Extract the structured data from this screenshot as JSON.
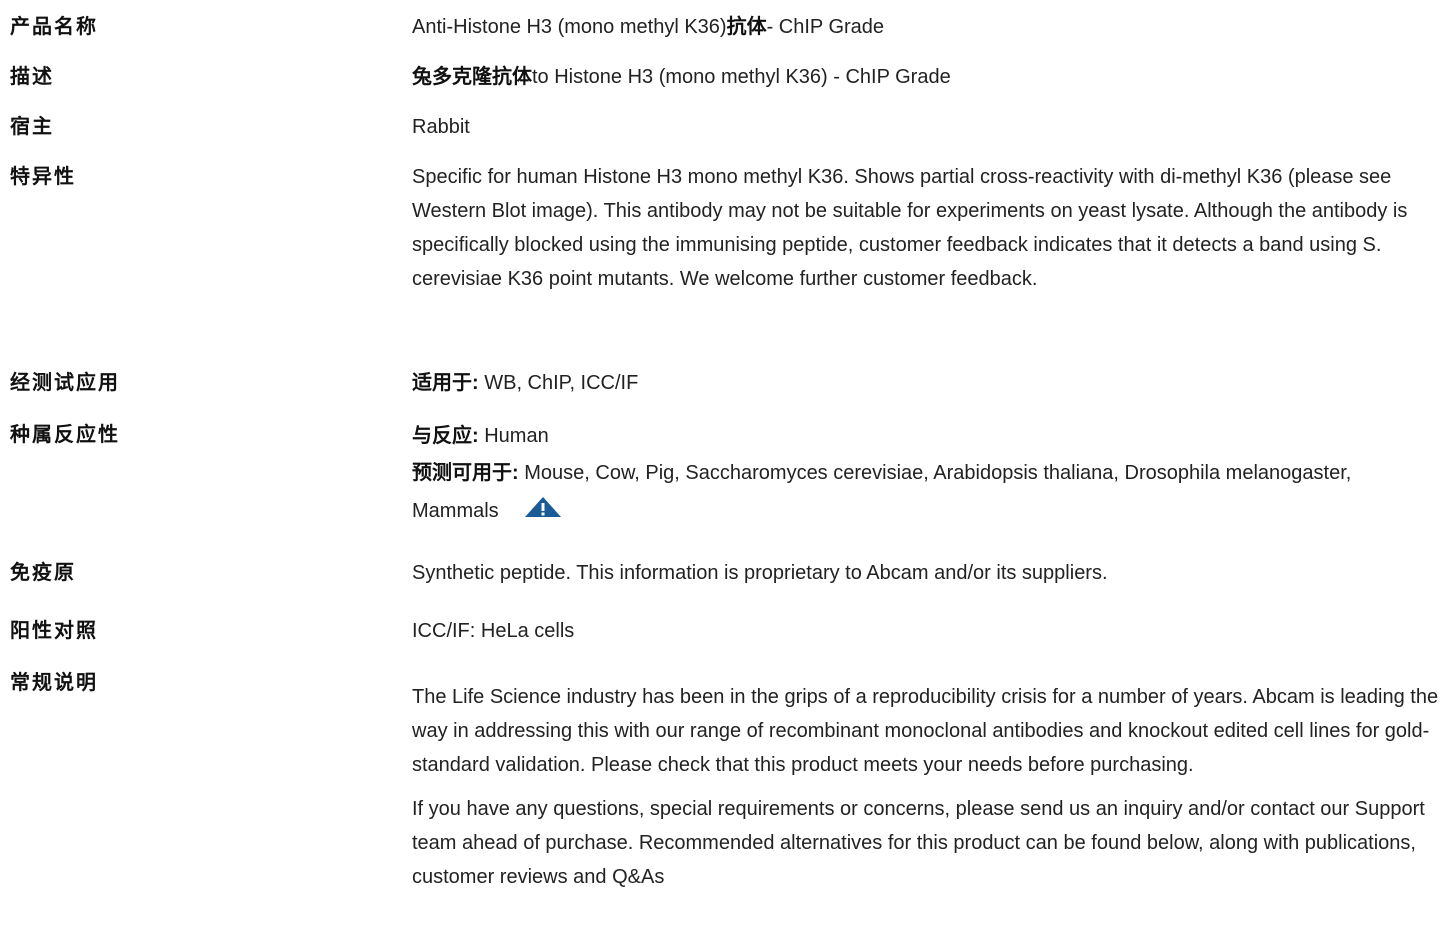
{
  "rows": {
    "product_name": {
      "label": "产品名称",
      "value_pre": "Anti-Histone H3 (mono methyl K36)",
      "value_bold": "抗体",
      "value_post": "- ChIP Grade"
    },
    "description": {
      "label": "描述",
      "value_bold": "兔多克隆抗体",
      "value_post": "to Histone H3 (mono methyl K36) - ChIP Grade"
    },
    "host": {
      "label": "宿主",
      "value": "Rabbit"
    },
    "specificity": {
      "label": "特异性",
      "value": "Specific for human Histone H3 mono methyl K36. Shows partial cross-reactivity with di-methyl K36 (please see Western Blot image). This antibody may not be suitable for experiments on yeast lysate. Although the antibody is specifically blocked using the immunising peptide, customer feedback indicates that it detects a band using S. cerevisiae K36 point mutants. We welcome further customer feedback."
    },
    "tested_applications": {
      "label": "经测试应用",
      "prefix": "适用于:",
      "value": " WB, ChIP, ICC/IF"
    },
    "species_reactivity": {
      "label": "种属反应性",
      "reacts_prefix": "与反应:",
      "reacts_value": " Human",
      "predicted_prefix": "预测可用于:",
      "predicted_value": " Mouse, Cow, Pig, Saccharomyces cerevisiae, Arabidopsis thaliana, Drosophila melanogaster, Mammals",
      "icon": "warning-triangle-icon",
      "icon_color": "#1a5a96"
    },
    "immunogen": {
      "label": "免疫原",
      "value": "Synthetic peptide. This information is proprietary to Abcam and/or its suppliers."
    },
    "positive_control": {
      "label": "阳性对照",
      "value": "ICC/IF: HeLa cells"
    },
    "general_notes": {
      "label": "常规说明",
      "paragraph_1": "The Life Science industry has been in the grips of a reproducibility crisis for a number of years. Abcam is leading the way in addressing this with our range of recombinant monoclonal antibodies and knockout edited cell lines for gold-standard validation. Please check that this product meets your needs before purchasing.",
      "paragraph_2": "If you have any questions, special requirements or concerns, please send us an inquiry and/or contact our Support team ahead of purchase. Recommended alternatives for this product can be found below, along with publications, customer reviews and Q&As"
    }
  }
}
